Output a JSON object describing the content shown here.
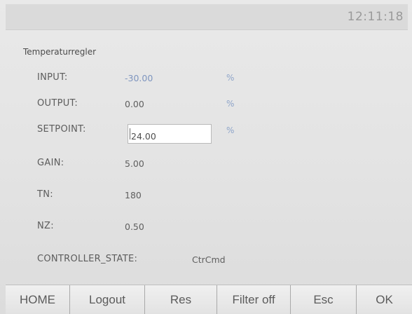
{
  "header": {
    "time": "12:11:18"
  },
  "panel": {
    "title": "Temperaturregler",
    "rows": {
      "input": {
        "label": "INPUT:",
        "value": "-30.00",
        "unit": "%"
      },
      "output": {
        "label": "OUTPUT:",
        "value": "0.00",
        "unit": "%"
      },
      "setpoint": {
        "label": "SETPOINT:",
        "value": "24.00",
        "unit": "%"
      },
      "gain": {
        "label": "GAIN:",
        "value": "5.00"
      },
      "tn": {
        "label": "TN:",
        "value": "180"
      },
      "nz": {
        "label": "NZ:",
        "value": "0.50"
      },
      "controller_state": {
        "label": "CONTROLLER_STATE:",
        "value": "CtrCmd"
      }
    }
  },
  "softkeys": {
    "home": "HOME",
    "logout": "Logout",
    "res": "Res",
    "filter": "Filter off",
    "esc": "Esc",
    "ok": "OK"
  },
  "colors": {
    "value_blue": "#7e95bf",
    "unit_blue": "#8ea4c9"
  }
}
